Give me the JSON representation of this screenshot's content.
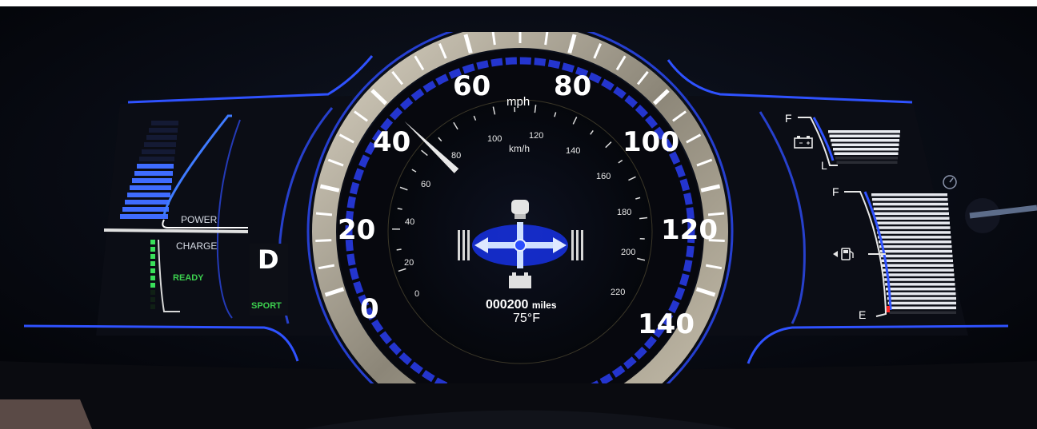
{
  "speedometer": {
    "mph_unit": "mph",
    "kmh_unit": "km/h",
    "mph_labels": [
      "0",
      "20",
      "40",
      "60",
      "80",
      "100",
      "120",
      "140"
    ],
    "kmh_labels": [
      "0",
      "20",
      "40",
      "60",
      "80",
      "100",
      "120",
      "140",
      "160",
      "180",
      "200",
      "220"
    ],
    "current_speed_mph": 40
  },
  "hybrid_meter": {
    "power_label": "POWER",
    "charge_label": "CHARGE",
    "ready_label": "READY",
    "power_level": 0.55,
    "charge_level": 0.65
  },
  "drive": {
    "gear": "D",
    "mode": "SPORT"
  },
  "info_display": {
    "odometer_value": "000200",
    "odometer_unit": "miles",
    "temperature": "75°F"
  },
  "battery_gauge": {
    "full_label": "F",
    "low_label": "L",
    "level": 0.8
  },
  "fuel_gauge": {
    "full_label": "F",
    "empty_label": "E",
    "level": 0.95
  },
  "colors": {
    "accent_blue": "#2a4dff",
    "charge_green": "#39e05a",
    "ready_green": "#3ccf4e",
    "needle": "#e8e8e8",
    "bezel": "#b9b1a0"
  }
}
